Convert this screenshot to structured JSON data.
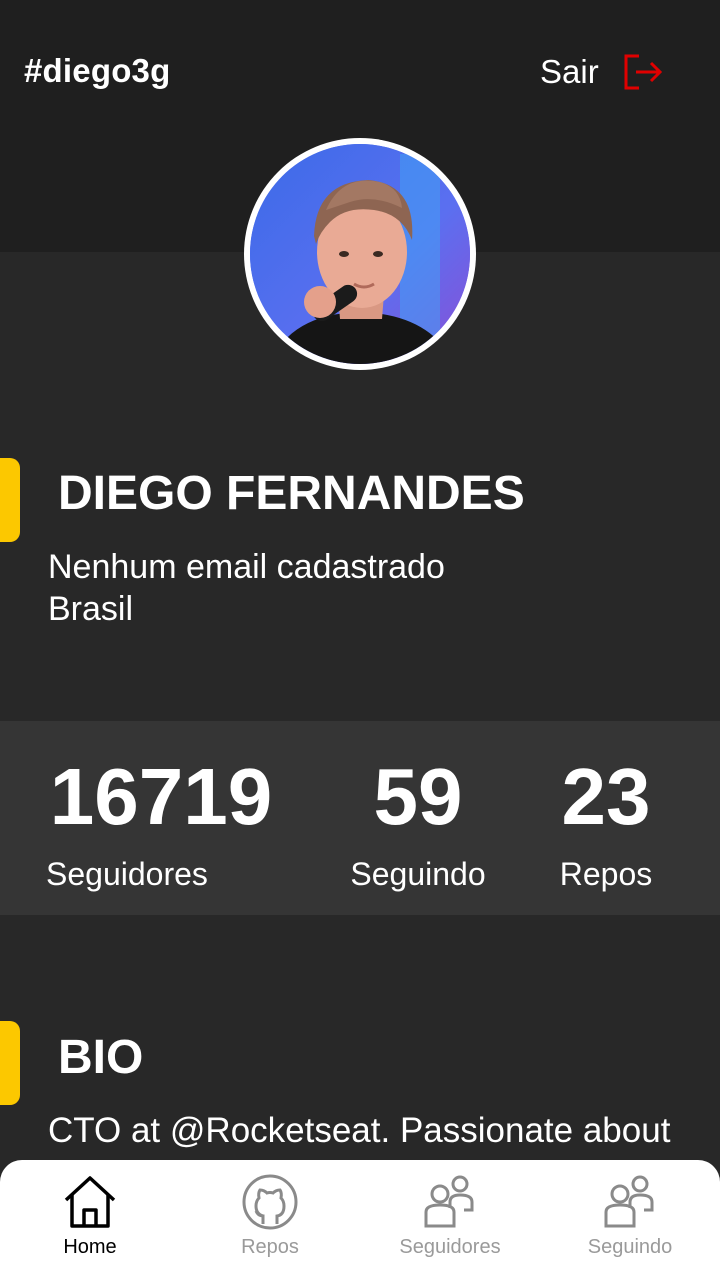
{
  "header": {
    "username": "#diego3g",
    "logout_label": "Sair",
    "logout_icon": "logout-icon",
    "accent_color": "#e00000"
  },
  "profile": {
    "avatar_icon": "avatar-photo",
    "name": "DIEGO FERNANDES",
    "email": "Nenhum email cadastrado",
    "location": "Brasil",
    "accent_color": "#fcc800"
  },
  "stats": [
    {
      "value": "16719",
      "label": "Seguidores"
    },
    {
      "value": "59",
      "label": "Seguindo"
    },
    {
      "value": "23",
      "label": "Repos"
    }
  ],
  "bio": {
    "title": "BIO",
    "text": "CTO at @Rocketseat. Passionate about"
  },
  "tabbar": {
    "items": [
      {
        "label": "Home",
        "icon": "home-icon",
        "active": true
      },
      {
        "label": "Repos",
        "icon": "github-icon",
        "active": false
      },
      {
        "label": "Seguidores",
        "icon": "users-icon",
        "active": false
      },
      {
        "label": "Seguindo",
        "icon": "users-icon",
        "active": false
      }
    ]
  }
}
